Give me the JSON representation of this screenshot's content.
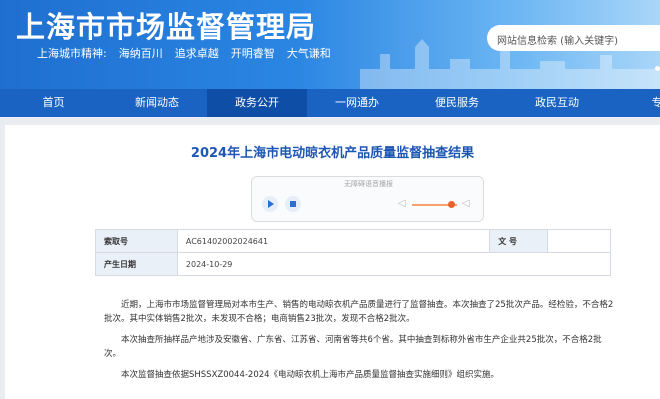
{
  "header": {
    "title": "上海市市场监督管理局",
    "spirit_label": "上海城市精神:",
    "spirit_items": [
      "海纳百川",
      "追求卓越",
      "开明睿智",
      "大气谦和"
    ],
    "search_placeholder": "网站信息检索 (输入关键字)"
  },
  "nav": {
    "items": [
      "首页",
      "新闻动态",
      "政务公开",
      "一网通办",
      "便民服务",
      "政民互动",
      "专"
    ],
    "active": "政务公开"
  },
  "article": {
    "title": "2024年上海市电动晾衣机产品质量监督抽查结果",
    "player_label": "无障碍语音播报",
    "index_label": "索取号",
    "index_value": "AC61402002024641",
    "docno_label": "文 号",
    "docno_value": "",
    "date_label": "产生日期",
    "date_value": "2024-10-29",
    "paragraphs": [
      "近期，上海市市场监督管理局对本市生产、销售的电动晾衣机产品质量进行了监督抽查。本次抽查了25批次产品。经检验，不合格2批次。其中实体销售2批次，未发现不合格；电商销售23批次，发现不合格2批次。",
      "本次抽查所抽样品产地涉及安徽省、广东省、江苏省、河南省等共6个省。其中抽查到标称外省市生产企业共25批次，不合格2批次。",
      "本次监督抽查依据SHSSXZ0044-2024《电动晾衣机上海市产品质量监督抽查实施细则》组织实施。"
    ]
  },
  "colors": {
    "header_blue": "#1f6fd0",
    "nav_blue": "#1b63c3",
    "nav_active": "#0f4ea6",
    "title_blue": "#1d56b5",
    "volume_accent": "#e8632b"
  }
}
